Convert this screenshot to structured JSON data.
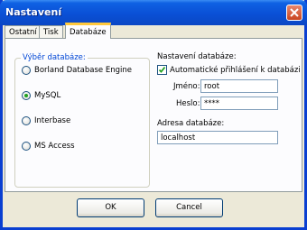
{
  "window": {
    "title": "Nastavení"
  },
  "tabs": [
    {
      "label": "Ostatní"
    },
    {
      "label": "Tisk"
    },
    {
      "label": "Databáze",
      "active": true
    }
  ],
  "db_group": {
    "legend": "Výběr databáze:",
    "options": [
      {
        "label": "Borland Database Engine",
        "checked": false
      },
      {
        "label": "MySQL",
        "checked": true
      },
      {
        "label": "Interbase",
        "checked": false
      },
      {
        "label": "MS Access",
        "checked": false
      }
    ]
  },
  "settings": {
    "heading": "Nastavení databáze:",
    "auto_login_label": "Automatické přihlášení k databázi",
    "auto_login_checked": true,
    "name_label": "Jméno:",
    "name_value": "root",
    "password_label": "Heslo:",
    "password_value": "****",
    "address_label": "Adresa databáze:",
    "address_value": "localhost"
  },
  "buttons": {
    "ok": "OK",
    "cancel": "Cancel"
  },
  "colors": {
    "titlebar": "#0a50d6",
    "accent_tab": "#ffc83c",
    "group_legend": "#0046d5",
    "check": "#21a121"
  }
}
